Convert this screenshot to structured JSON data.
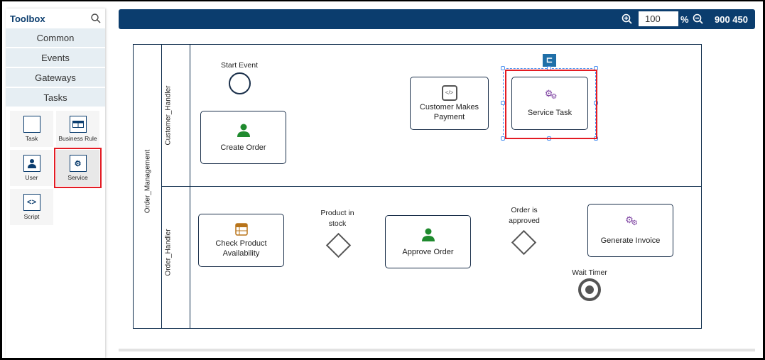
{
  "toolbox": {
    "title": "Toolbox",
    "search_icon": "search-icon",
    "categories": [
      "Common",
      "Events",
      "Gateways",
      "Tasks"
    ],
    "tools": [
      {
        "label": "Task",
        "icon": "task-icon"
      },
      {
        "label": "Business Rule",
        "icon": "table-icon"
      },
      {
        "label": "User",
        "icon": "user-icon"
      },
      {
        "label": "Service",
        "icon": "gear-icon"
      },
      {
        "label": "Script",
        "icon": "code-icon"
      }
    ]
  },
  "topbar": {
    "zoom_value": "100",
    "percent": "%",
    "dimensions": "900 450"
  },
  "diagram": {
    "pool": "Order_Management",
    "lanes": [
      "Customer_Handler",
      "Order_Handler"
    ],
    "start_event": "Start Event",
    "tasks": {
      "create_order": "Create Order",
      "customer_payment": "Customer Makes Payment",
      "service_task": "Service Task",
      "check_product": "Check Product Availability",
      "approve_order": "Approve Order",
      "generate_invoice": "Generate Invoice"
    },
    "gateways": {
      "product_in_stock": "Product in stock",
      "order_approved": "Order is approved"
    },
    "timer": "Wait Timer"
  },
  "colors": {
    "primary": "#0b3d6e",
    "highlight": "#e31b23",
    "service_icon": "#7b3fa0",
    "user_icon": "#1f8a2e",
    "rule_icon": "#b8741a"
  }
}
